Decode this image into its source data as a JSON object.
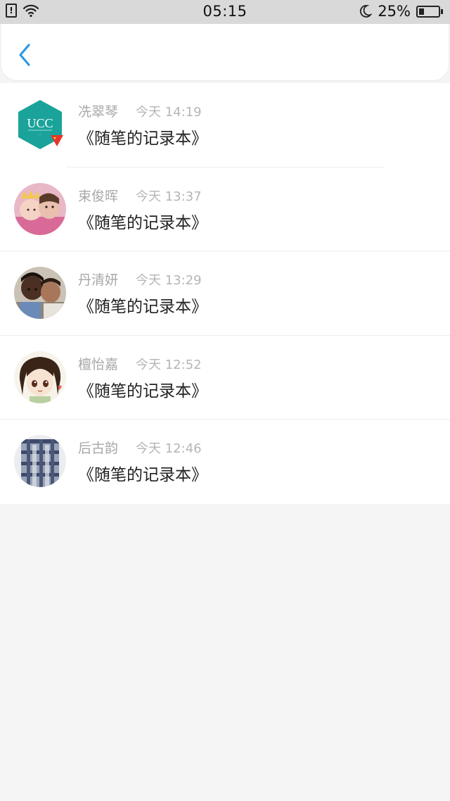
{
  "status_bar": {
    "sim_glyph": "!",
    "time": "05:15",
    "battery_percent": "25%",
    "battery_level": 0.25,
    "icons": [
      "sim-icon",
      "wifi-icon",
      "moon-icon",
      "battery-icon"
    ]
  },
  "header": {
    "back_icon": "chevron-left-icon",
    "accent_color": "#2b9ae6"
  },
  "list": {
    "items": [
      {
        "name": "冼翠琴",
        "time": "今天 14:19",
        "title": "《随笔的记录本》",
        "avatar": "ucc-logo",
        "avatar_text": "UCC"
      },
      {
        "name": "束俊晖",
        "time": "今天 13:37",
        "title": "《随笔的记录本》",
        "avatar": "photo-children"
      },
      {
        "name": "丹清妍",
        "time": "今天 13:29",
        "title": "《随笔的记录本》",
        "avatar": "photo-boys"
      },
      {
        "name": "檀怡嘉",
        "time": "今天 12:52",
        "title": "《随笔的记录本》",
        "avatar": "anime-girl"
      },
      {
        "name": "后古韵",
        "time": "今天 12:46",
        "title": "《随笔的记录本》",
        "avatar": "photo-plaid-shirt"
      }
    ]
  },
  "colors": {
    "background": "#f5f5f5",
    "status_bar": "#d9d9d9",
    "name_text": "#a8a8a8",
    "title_text": "#222222",
    "ucc_teal": "#1aa39b"
  }
}
